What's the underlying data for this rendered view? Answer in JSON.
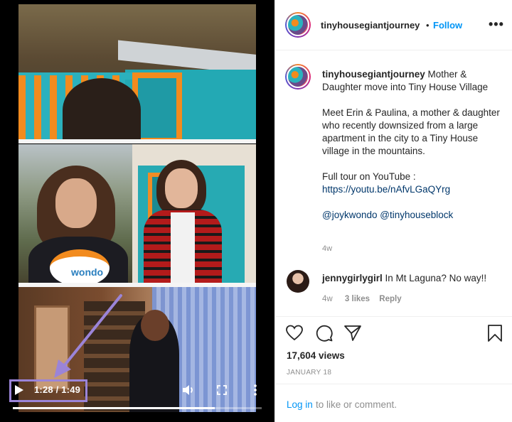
{
  "video": {
    "time_display": "1:28 / 1:49",
    "progress_fraction": 0.81,
    "overlay_logo_text": "wondo"
  },
  "header": {
    "username": "tinyhousegiantjourney",
    "separator": "•",
    "follow_label": "Follow",
    "more_label": "•••"
  },
  "caption": {
    "username": "tinyhousegiantjourney",
    "title": "Mother & Daughter move into Tiny House Village",
    "body": "Meet Erin & Paulina, a mother & daughter who recently downsized from a large apartment in the city to a Tiny House village in the mountains.",
    "tour_label": "Full tour on YouTube :",
    "tour_link": "https://youtu.be/nAfvLGaQYrg",
    "mentions": "@joykwondo @tinyhouseblock",
    "age": "4w"
  },
  "comment": {
    "username": "jennygirlygirl",
    "text": "In Mt Laguna? No way!!",
    "age": "4w",
    "likes": "3 likes",
    "reply_label": "Reply"
  },
  "stats": {
    "views": "17,604 views",
    "date": "JANUARY 18"
  },
  "footer": {
    "login_label": "Log in",
    "rest_label": "to like or comment."
  },
  "icons": {
    "play": "play-icon",
    "volume": "volume-icon",
    "fullscreen": "fullscreen-icon",
    "more": "more-vertical-icon",
    "like": "heart-icon",
    "comment": "comment-icon",
    "share": "send-icon",
    "save": "bookmark-icon"
  },
  "colors": {
    "link_blue": "#0095f6",
    "annotation_purple": "#9b84d8"
  }
}
